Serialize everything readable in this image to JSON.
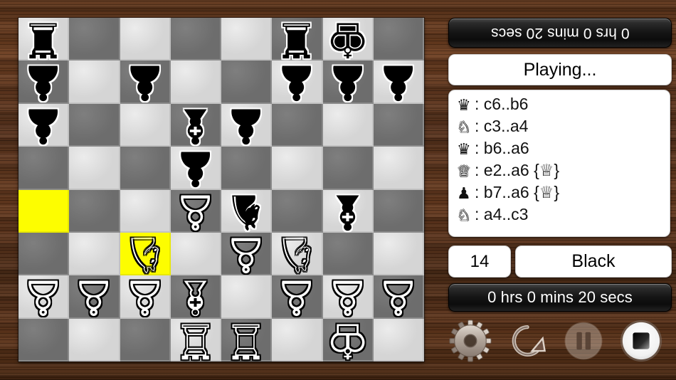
{
  "app": {
    "title": "Chess",
    "background_color": "#5c3318"
  },
  "clocks": {
    "top_label": "0 hrs 0 mins 20 secs",
    "bottom_label": "0 hrs 0 mins 20 secs",
    "top_rotated": true
  },
  "status": {
    "text": "Playing..."
  },
  "move_number": "14",
  "turn": "Black",
  "move_list": [
    {
      "glyph": "♛",
      "color": "b",
      "text": ": c6..b6"
    },
    {
      "glyph": "♘",
      "color": "w",
      "text": ": c3..a4"
    },
    {
      "glyph": "♛",
      "color": "b",
      "text": ": b6..a6"
    },
    {
      "glyph": "♕",
      "color": "w",
      "text": ": e2..a6 {♕}"
    },
    {
      "glyph": "♟",
      "color": "b",
      "text": ": b7..a6 {♕}"
    },
    {
      "glyph": "♘",
      "color": "w",
      "text": ": a4..c3"
    }
  ],
  "controls": [
    {
      "name": "settings",
      "icon": "gear-icon",
      "label": "Settings"
    },
    {
      "name": "undo",
      "icon": "rotate-arrow-icon",
      "label": "Restart"
    },
    {
      "name": "pause",
      "icon": "pause-icon",
      "label": "Pause"
    },
    {
      "name": "stop",
      "icon": "stop-icon",
      "label": "Stop"
    }
  ],
  "board": {
    "light_color": "#d5d5d5",
    "dark_color": "#6d6d6d",
    "highlight_color": "#fdfd00",
    "flipped": true,
    "highlights": [
      [
        4,
        0
      ],
      [
        5,
        2
      ]
    ],
    "rows": [
      [
        "bR",
        "",
        "",
        "",
        "",
        "bR",
        "bK",
        ""
      ],
      [
        "bP",
        "",
        "bP",
        "",
        "",
        "bP",
        "bP",
        "bP"
      ],
      [
        "bP",
        "",
        "",
        "bB",
        "bP",
        "",
        "",
        ""
      ],
      [
        "",
        "",
        "",
        "bP",
        "",
        "",
        "",
        ""
      ],
      [
        "",
        "",
        "",
        "wP",
        "bN",
        "",
        "bB",
        ""
      ],
      [
        "",
        "",
        "wN",
        "",
        "wP",
        "wN",
        "",
        ""
      ],
      [
        "wP",
        "wP",
        "wP",
        "wB",
        "",
        "wP",
        "wP",
        "wP"
      ],
      [
        "",
        "",
        "",
        "wR",
        "wR",
        "",
        "wK",
        ""
      ]
    ]
  }
}
